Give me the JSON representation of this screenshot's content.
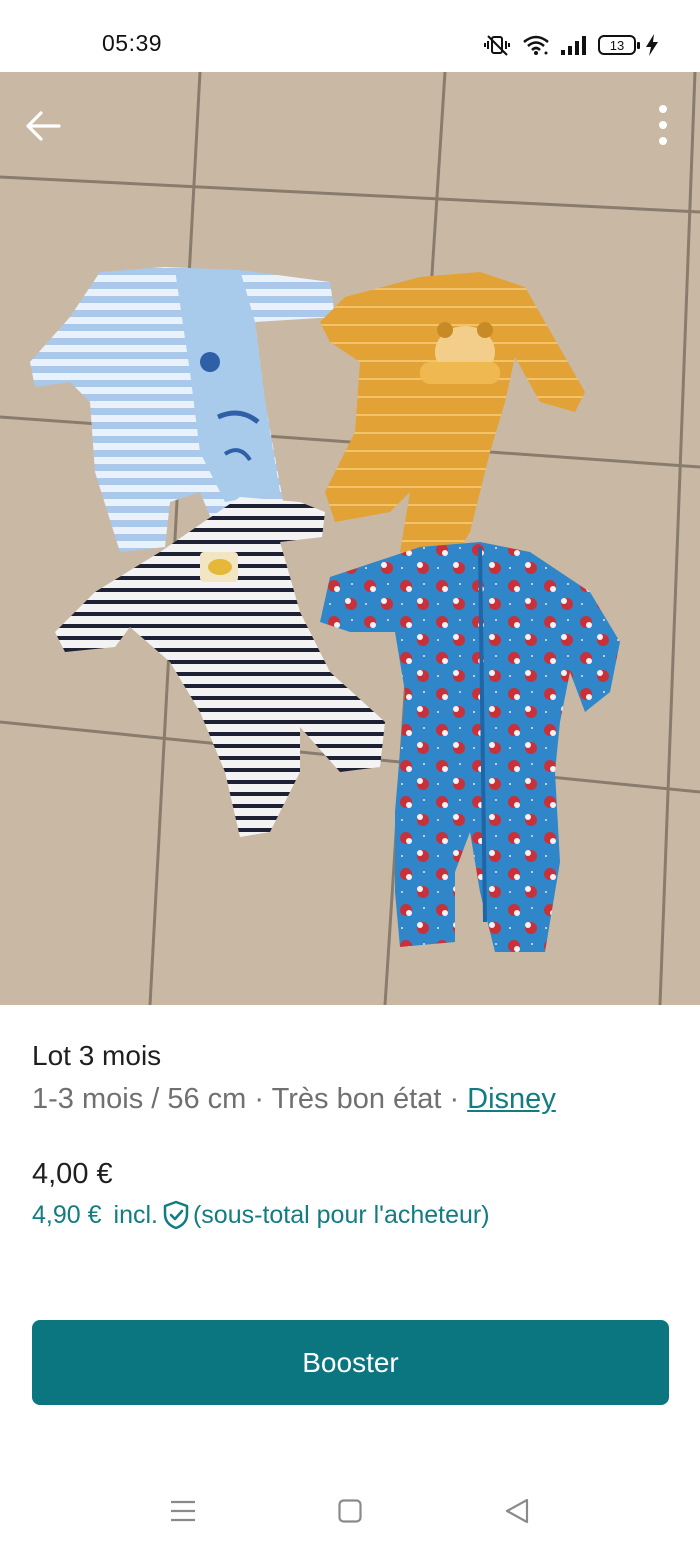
{
  "status_bar": {
    "time": "05:39",
    "battery": "13",
    "icons": [
      "vibrate-off-icon",
      "wifi-icon",
      "signal-icon",
      "battery-icon",
      "charging-icon"
    ]
  },
  "photo": {
    "alt": "Lot 3 mois",
    "icons": [
      "back-arrow-icon",
      "more-vertical-icon"
    ]
  },
  "listing": {
    "title": "Lot 3 mois",
    "size": "1-3 mois / 56 cm",
    "separator": " · ",
    "condition": "Très bon état",
    "brand": "Disney",
    "price": "4,00 €",
    "price_incl_amount": "4,90 €",
    "price_incl_label": "incl.",
    "price_incl_note": "(sous-total pour l'acheteur)"
  },
  "actions": {
    "booster_label": "Booster"
  },
  "nav_bar": {
    "icons": [
      "menu-icon",
      "home-square-icon",
      "back-triangle-icon"
    ]
  },
  "colors": {
    "accent": "#127c80",
    "button": "#0b7680"
  }
}
